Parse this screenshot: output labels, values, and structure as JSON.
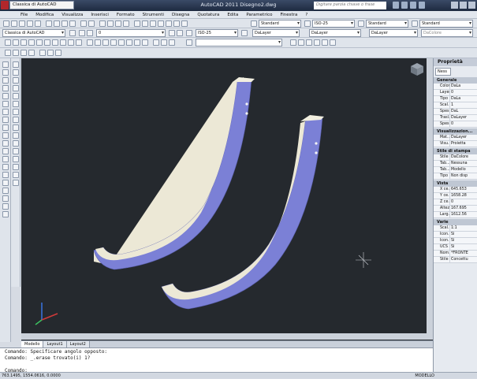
{
  "window": {
    "title": "AutoCAD 2011   Disegno2.dwg",
    "workspace": "Classica di AutoCAD",
    "search_placeholder": "Digitare parola chiave o frase"
  },
  "menu": [
    "File",
    "Modifica",
    "Visualizza",
    "Inserisci",
    "Formato",
    "Strumenti",
    "Disegna",
    "Quotatura",
    "Edita",
    "Parametrico",
    "Finestra",
    "?"
  ],
  "toolbars": {
    "text_style": "Standard",
    "dim_style": "ISO-25",
    "table_style": "Standard",
    "mleader_style": "Standard",
    "workspace2": "Classica di AutoCAD",
    "layer": "0",
    "dim_style2": "ISO-25",
    "color": "DaLayer",
    "linetype": "DaLayer",
    "lineweight": "DaLayer",
    "plotstyle": "DaColore"
  },
  "tabs": [
    "Modello",
    "Layout1",
    "Layout2"
  ],
  "command_lines": [
    "Comando: Specificare angolo opposto:",
    "Comando: _.erase trovato(i) 1?",
    "",
    "Comando:"
  ],
  "status": {
    "coords": "763.1495, 1554.0616, 0.0000",
    "model": "MODELLO"
  },
  "properties": {
    "title": "Proprietà",
    "selector": "Ness",
    "groups": [
      {
        "name": "Generale",
        "rows": [
          {
            "k": "Colore",
            "v": "DaLa"
          },
          {
            "k": "Layer",
            "v": "0"
          },
          {
            "k": "Tipo ...",
            "v": "DaLa"
          },
          {
            "k": "Scal...",
            "v": "1"
          },
          {
            "k": "Spes...",
            "v": "DaL"
          },
          {
            "k": "Trasl...",
            "v": "DaLayer"
          },
          {
            "k": "Spes...",
            "v": "0"
          }
        ]
      },
      {
        "name": "Visualizzazion...",
        "rows": [
          {
            "k": "Mat...",
            "v": "DaLayer"
          },
          {
            "k": "Visu...",
            "v": "Proietta"
          }
        ]
      },
      {
        "name": "Stile di stampa",
        "rows": [
          {
            "k": "Stile ...",
            "v": "DaColore"
          },
          {
            "k": "Tab...",
            "v": "Nessuna"
          },
          {
            "k": "Tab...",
            "v": "Modello"
          },
          {
            "k": "Tipo ...",
            "v": "Non disp"
          }
        ]
      },
      {
        "name": "Vista",
        "rows": [
          {
            "k": "X ce...",
            "v": "645.653"
          },
          {
            "k": "Y ce...",
            "v": "1658.28"
          },
          {
            "k": "Z ce...",
            "v": "0"
          },
          {
            "k": "Altezza",
            "v": "167.695"
          },
          {
            "k": "Larg...",
            "v": "1612.56"
          }
        ]
      },
      {
        "name": "Varie",
        "rows": [
          {
            "k": "Scal...",
            "v": "1:1"
          },
          {
            "k": "Icon...",
            "v": "Sì"
          },
          {
            "k": "Icon...",
            "v": "Sì"
          },
          {
            "k": "UCS ...",
            "v": "Sì"
          },
          {
            "k": "Nom...",
            "v": "*FRONTE"
          },
          {
            "k": "Stile ...",
            "v": "Concettu"
          }
        ]
      }
    ]
  },
  "colors": {
    "canvas": "#25292e",
    "part_face": "#7b80d6",
    "part_edge": "#ece8d6"
  }
}
